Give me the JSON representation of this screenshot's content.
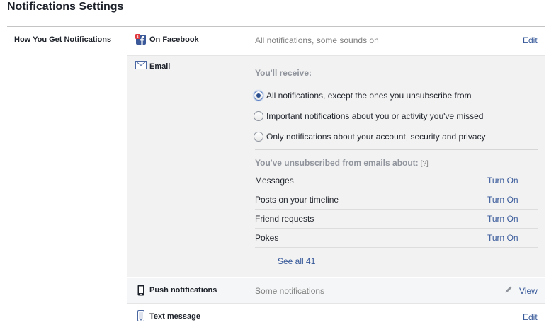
{
  "page_title": "Notifications Settings",
  "section_label": "How You Get Notifications",
  "facebook": {
    "label": "On Facebook",
    "value": "All notifications, some sounds on",
    "edit_label": "Edit",
    "icon": "facebook-notification-icon"
  },
  "email": {
    "label": "Email",
    "icon": "envelope-icon",
    "receive_title": "You'll receive:",
    "options": [
      {
        "label": "All notifications, except the ones you unsubscribe from",
        "checked": true
      },
      {
        "label": "Important notifications about you or activity you've missed",
        "checked": false
      },
      {
        "label": "Only notifications about your account, security and privacy",
        "checked": false
      }
    ],
    "unsubscribed_title": "You've unsubscribed from emails about:",
    "help_tag": "[?]",
    "unsubscribed": [
      {
        "name": "Messages",
        "action": "Turn On"
      },
      {
        "name": "Posts on your timeline",
        "action": "Turn On"
      },
      {
        "name": "Friend requests",
        "action": "Turn On"
      },
      {
        "name": "Pokes",
        "action": "Turn On"
      }
    ],
    "see_all_label": "See all 41"
  },
  "push": {
    "label": "Push notifications",
    "icon": "mobile-phone-icon",
    "value": "Some notifications",
    "view_label": "View",
    "edit_icon": "pencil-icon"
  },
  "text_message": {
    "label": "Text message",
    "icon": "mobile-phone-icon",
    "edit_label": "Edit"
  },
  "colors": {
    "link": "#365899",
    "muted": "#7f7f7f",
    "panel_bg": "#f2f2f2"
  }
}
